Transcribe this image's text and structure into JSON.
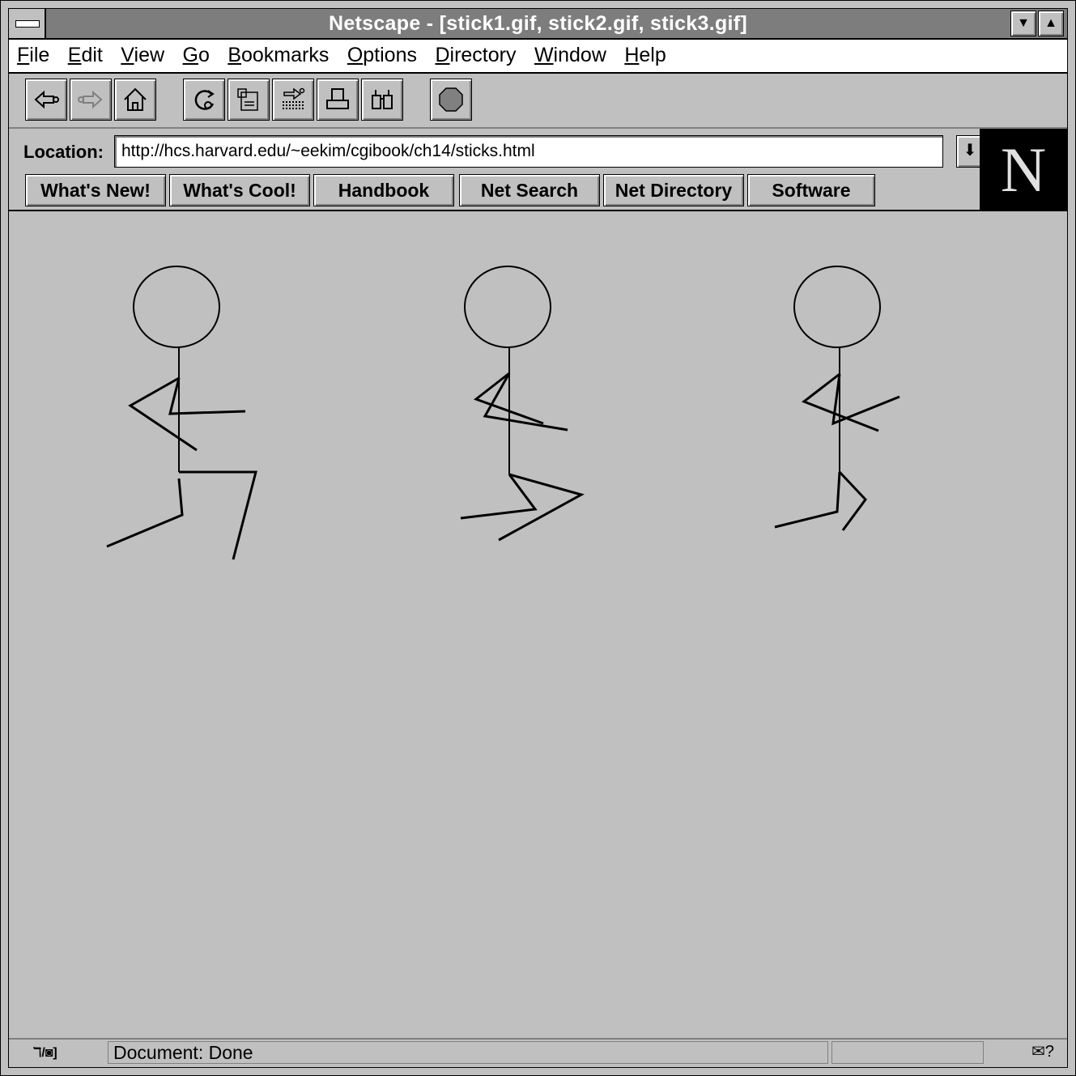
{
  "window": {
    "title": "Netscape - [stick1.gif, stick2.gif, stick3.gif]"
  },
  "menu": [
    {
      "label": "File"
    },
    {
      "label": "Edit"
    },
    {
      "label": "View"
    },
    {
      "label": "Go"
    },
    {
      "label": "Bookmarks"
    },
    {
      "label": "Options"
    },
    {
      "label": "Directory"
    },
    {
      "label": "Window"
    },
    {
      "label": "Help"
    }
  ],
  "toolbar": {
    "icons": [
      "back-icon",
      "forward-icon",
      "home-icon",
      "reload-icon",
      "images-icon",
      "open-icon",
      "print-icon",
      "find-icon",
      "stop-icon"
    ]
  },
  "location": {
    "label": "Location:",
    "url": "http://hcs.harvard.edu/~eekim/cgibook/ch14/sticks.html"
  },
  "directory_buttons": [
    {
      "label": "What's New!"
    },
    {
      "label": "What's Cool!"
    },
    {
      "label": "Handbook"
    },
    {
      "label": "Net Search"
    },
    {
      "label": "Net Directory"
    },
    {
      "label": "Software"
    }
  ],
  "status": {
    "text": "Document: Done"
  },
  "colors": {
    "title_bar": "#7d7d7d",
    "background": "#c0c0c0"
  }
}
